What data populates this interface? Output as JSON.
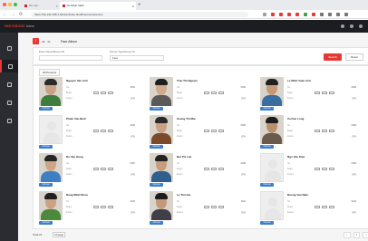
{
  "browser": {
    "tabs": [
      {
        "label": "Nh..sim..."
      },
      {
        "label": "hv-Nhan hanh"
      }
    ],
    "url": "https://hik.192.168.1.64/doc/index.html#/resource/person"
  },
  "app": {
    "brand": "HIKVISION",
    "brand_suffix": "Ivms"
  },
  "toolbar": {
    "back_icon": "back-arrow-icon",
    "left_label": "All",
    "count_label": "21",
    "title": "Face Album"
  },
  "filters": {
    "name_label": "Enter Name/Person ID",
    "name_placeholder": "",
    "type_label": "Person Type/Group ID",
    "type_value": "Face",
    "search_label": "Search",
    "reset_label": "Reset"
  },
  "subtab": "All Persons",
  "cards": [
    {
      "name": "Nguyen Van Anh",
      "badge": "Normal",
      "photo": "face",
      "shirt": "#3e7d3e",
      "face": "#c9a184",
      "hair": "#2b2b2b",
      "r1": "No.",
      "v1": "0001",
      "r2": "Begin",
      "r3": "Expire",
      "v3": "yyyy"
    },
    {
      "name": "Tran Thi Nguyet",
      "badge": "Normal",
      "photo": "face",
      "shirt": "#5a5a5a",
      "face": "#d0a88a",
      "hair": "#1f1f1f",
      "r1": "No.",
      "v1": "0002",
      "r2": "Begin",
      "r3": "Expire",
      "v3": "yyyy"
    },
    {
      "name": "Le Minh Tuan Anh",
      "badge": "Normal",
      "photo": "face",
      "shirt": "#3a6e9e",
      "face": "#c59977",
      "hair": "#222222",
      "r1": "No.",
      "v1": "0003",
      "r2": "Begin",
      "r3": "Expire",
      "v3": "yyyy"
    },
    {
      "name": "Pham Van Binh",
      "badge": "Normal",
      "photo": "placeholder",
      "r1": "No.",
      "v1": "0004",
      "r2": "Begin",
      "r3": "Expire",
      "v3": "yyyy"
    },
    {
      "name": "Hoang Thi Mai",
      "badge": "Normal",
      "photo": "face",
      "shirt": "#7a4a2a",
      "face": "#caa182",
      "hair": "#2a2a2a",
      "r1": "No.",
      "v1": "0005",
      "r2": "Begin",
      "r3": "Expire",
      "v3": "yyyy"
    },
    {
      "name": "Vu Duc Long",
      "badge": "Normal",
      "photo": "face",
      "shirt": "#6b5a4a",
      "face": "#b8906f",
      "hair": "#1d1d1d",
      "r1": "No.",
      "v1": "0006",
      "r2": "Begin",
      "r3": "Expire",
      "v3": "yyyy"
    },
    {
      "name": "Do Van Hung",
      "badge": "Normal",
      "photo": "face",
      "shirt": "#3d7fc4",
      "face": "#cfa585",
      "hair": "#262626",
      "r1": "No.",
      "v1": "0007",
      "r2": "Begin",
      "r3": "Expire",
      "v3": "yyyy"
    },
    {
      "name": "Bui Thi Lan",
      "badge": "Normal",
      "photo": "face",
      "shirt": "#2f5f8f",
      "face": "#c89d7d",
      "hair": "#222222",
      "r1": "No.",
      "v1": "0008",
      "r2": "Begin",
      "r3": "Expire",
      "v3": "yyyy"
    },
    {
      "name": "Ngo Van Kien",
      "badge": "Normal",
      "photo": "placeholder",
      "r1": "No.",
      "v1": "0009",
      "r2": "Begin",
      "r3": "Expire",
      "v3": "yyyy"
    },
    {
      "name": "Dang Minh Khoa",
      "badge": "Normal",
      "photo": "face",
      "shirt": "#4a8a3a",
      "face": "#cda283",
      "hair": "#202020",
      "r1": "No.",
      "v1": "0010",
      "r2": "Begin",
      "r3": "Expire",
      "v3": "yyyy"
    },
    {
      "name": "Ly Thi Hoa",
      "badge": "Normal",
      "photo": "face",
      "shirt": "#3f3f4a",
      "face": "#c6997a",
      "hair": "#1c1c1c",
      "r1": "No.",
      "v1": "0011",
      "r2": "Begin",
      "r3": "Expire",
      "v3": "yyyy"
    },
    {
      "name": "Duong Van Nam",
      "badge": "Normal",
      "photo": "placeholder",
      "r1": "No.",
      "v1": "0012",
      "r2": "Begin",
      "r3": "Expire",
      "v3": "yyyy"
    }
  ],
  "pagination": {
    "label": "Total 21",
    "page_size": "12/page",
    "prev": "<",
    "page": "1",
    "next": ">"
  },
  "colors": {
    "accent": "#e53935",
    "badge": "#3b7fd1",
    "header_bg": "#1b1d21",
    "sidebar_bg": "#2a2c31"
  }
}
